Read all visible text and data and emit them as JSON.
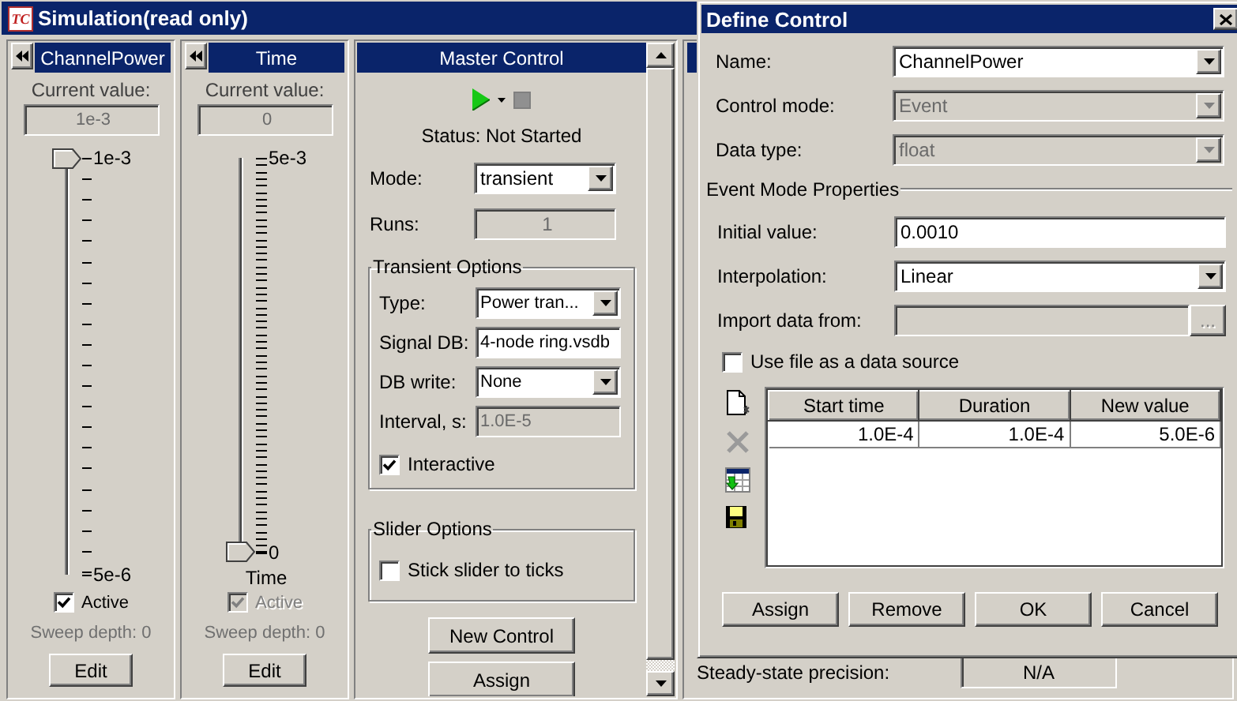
{
  "main_window": {
    "logo": "TC",
    "title": "Simulation(read only)"
  },
  "controls": [
    {
      "title": "ChannelPower",
      "current_value_label": "Current value:",
      "current_value": "1e-3",
      "slider": {
        "kind": "coarse",
        "max_label": "1e-3",
        "min_label": "5e-6",
        "level": 1
      },
      "active": {
        "label": "Active",
        "checked": true,
        "disabled": false
      },
      "sweep_depth": "Sweep depth: 0",
      "button": "Edit"
    },
    {
      "title": "Time",
      "current_value_label": "Current value:",
      "current_value": "0",
      "slider": {
        "kind": "fine",
        "max_label": "5e-3",
        "min_label": "0",
        "level": 0,
        "caption": "Time"
      },
      "active": {
        "label": "Active",
        "checked": true,
        "disabled": true
      },
      "sweep_depth": "Sweep depth: 0",
      "button": "Edit"
    }
  ],
  "master_control": {
    "title": "Master Control",
    "status": "Status: Not Started",
    "mode": {
      "label": "Mode:",
      "value": "transient"
    },
    "runs": {
      "label": "Runs:",
      "value": "1",
      "disabled": true
    },
    "transient_options": {
      "title": "Transient Options",
      "fields": [
        {
          "kind": "dropdown",
          "label": "Type:",
          "value": "Power tran...",
          "disabled": false
        },
        {
          "kind": "text",
          "label": "Signal DB:",
          "value": "4-node ring.vsdb",
          "disabled": false
        },
        {
          "kind": "dropdown",
          "label": "DB write:",
          "value": "None",
          "disabled": false
        },
        {
          "kind": "text",
          "label": "Interval, s:",
          "value": "1.0E-5",
          "disabled": true
        }
      ],
      "interactive": {
        "label": "Interactive",
        "checked": true
      }
    },
    "slider_options": {
      "title": "Slider Options",
      "stick": {
        "label": "Stick slider to ticks",
        "checked": false
      }
    },
    "buttons": [
      "New Control",
      "Assign"
    ]
  },
  "steady_state": {
    "label": "Steady-state precision:",
    "value": "N/A"
  },
  "dialog": {
    "title": "Define Control",
    "fields": [
      {
        "kind": "dropdown",
        "label": "Name:",
        "value": "ChannelPower",
        "disabled": false
      },
      {
        "kind": "dropdown",
        "label": "Control mode:",
        "value": "Event",
        "disabled": true
      },
      {
        "kind": "dropdown",
        "label": "Data type:",
        "value": "float",
        "disabled": true
      }
    ],
    "section": "Event Mode Properties",
    "event_fields": [
      {
        "kind": "text",
        "label": "Initial value:",
        "value": "0.0010",
        "disabled": false
      },
      {
        "kind": "dropdown",
        "label": "Interpolation:",
        "value": "Linear",
        "disabled": false
      },
      {
        "kind": "browse",
        "label": "Import data from:",
        "disabled": true,
        "button": "..."
      }
    ],
    "use_file": {
      "label": "Use file as a data source",
      "checked": false
    },
    "tools": [
      {
        "kind": "new",
        "disabled": false
      },
      {
        "kind": "delete",
        "disabled": true
      },
      {
        "kind": "import",
        "disabled": false
      },
      {
        "kind": "save",
        "disabled": false
      }
    ],
    "table": {
      "columns": [
        "Start time",
        "Duration",
        "New value"
      ],
      "rows": [
        [
          "1.0E-4",
          "1.0E-4",
          "5.0E-6"
        ]
      ]
    },
    "buttons": [
      "Assign",
      "Remove",
      "OK",
      "Cancel"
    ]
  }
}
